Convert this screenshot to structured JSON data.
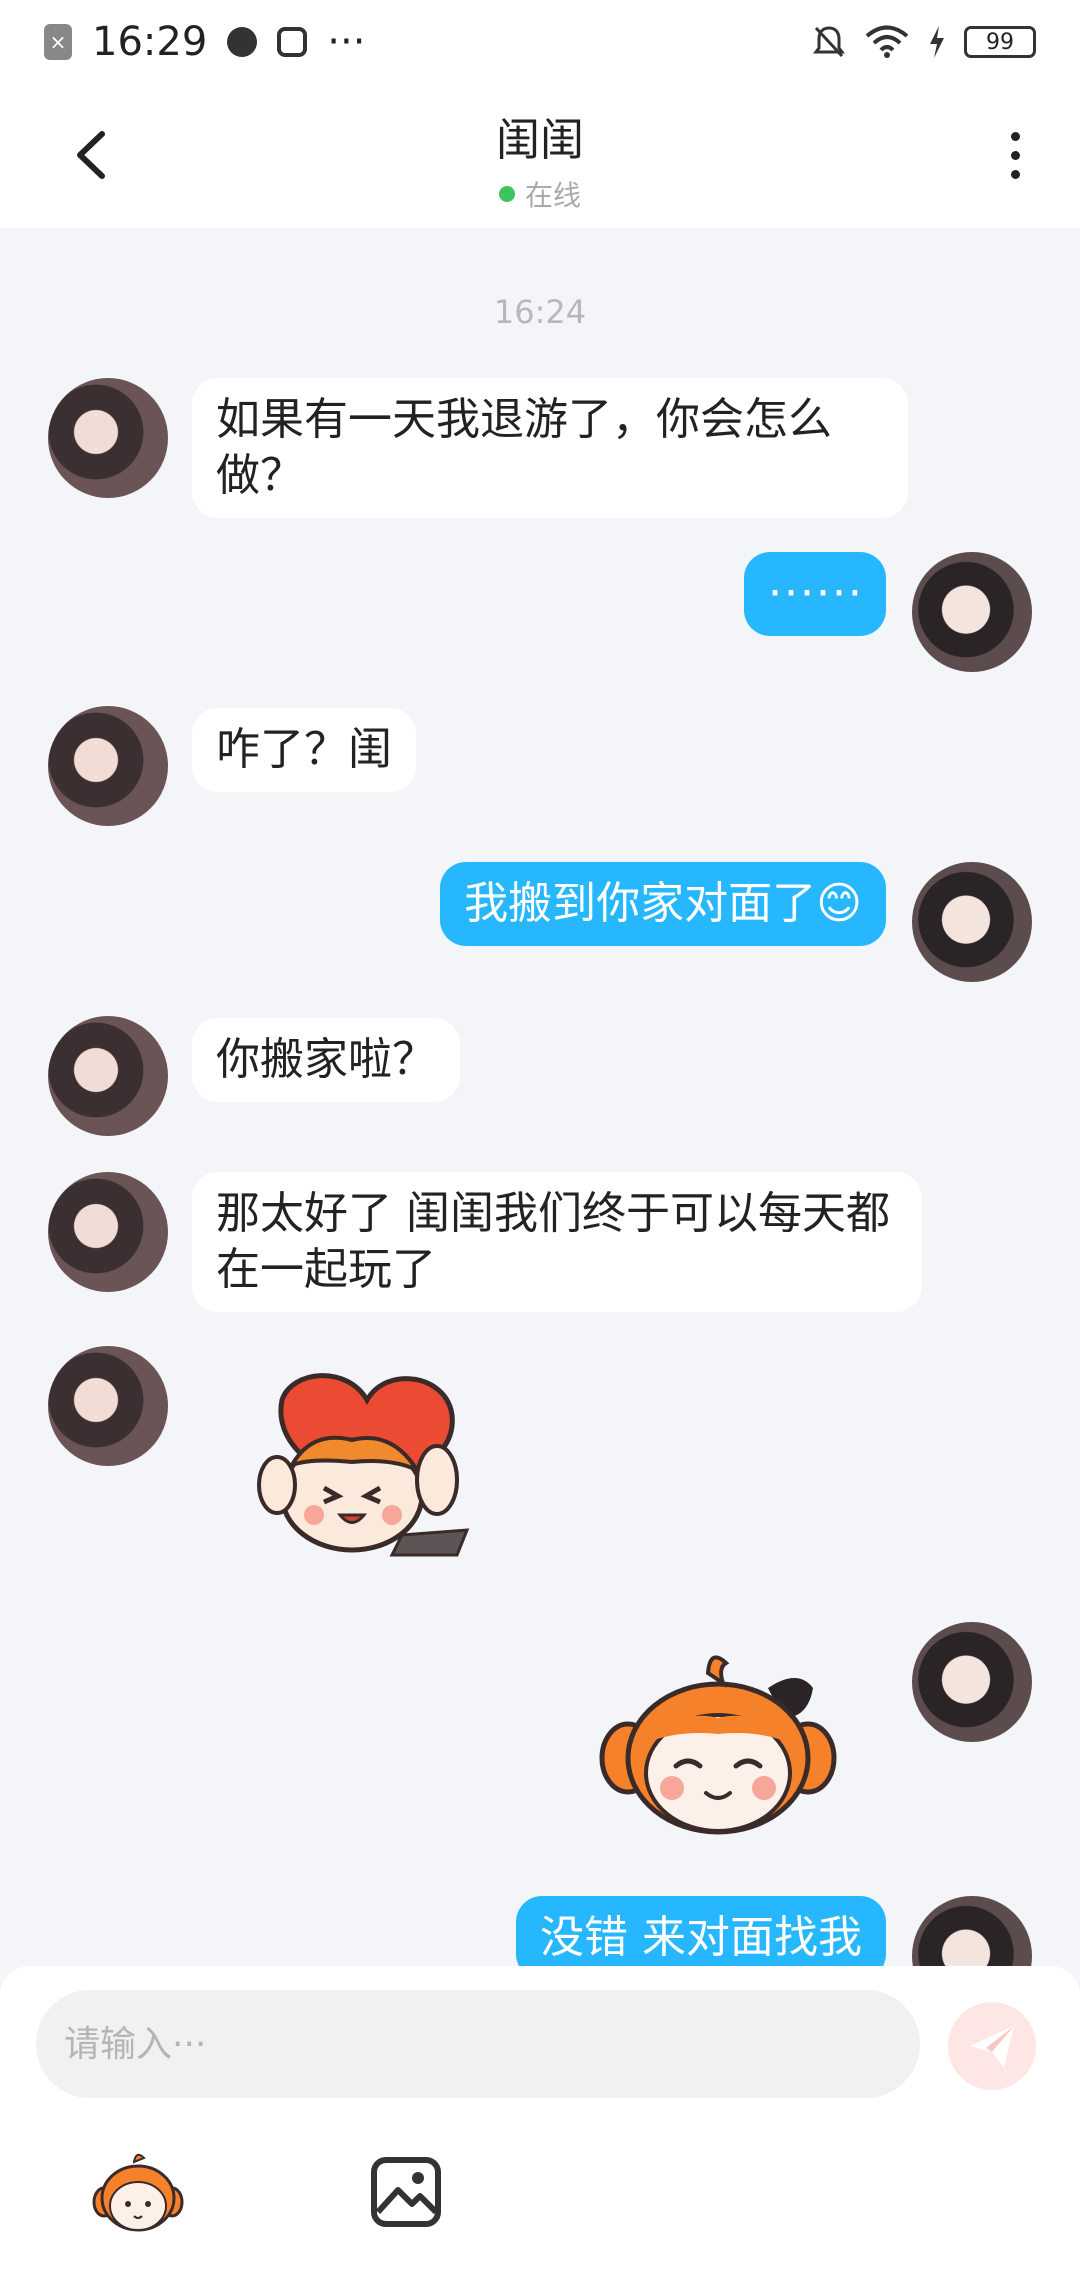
{
  "status_bar": {
    "time": "16:29",
    "overflow": "···",
    "battery": "99",
    "icons": [
      "notification-badge-icon",
      "planet-app-icon",
      "play-app-icon",
      "bell-off-icon",
      "wifi-icon",
      "charging-icon",
      "battery-icon"
    ]
  },
  "header": {
    "title": "闺闺",
    "status": "在线",
    "status_color": "#3ec45a"
  },
  "chat": {
    "timestamp": "16:24",
    "messages": [
      {
        "from": "friend",
        "text": "如果有一天我退游了，你会怎么做？"
      },
      {
        "from": "me",
        "text": "······"
      },
      {
        "from": "friend",
        "text": "咋了？闺"
      },
      {
        "from": "me",
        "text": "我搬到你家对面了😊"
      },
      {
        "from": "friend",
        "text": "你搬家啦？"
      },
      {
        "from": "friend",
        "text": "那太好了 闺闺我们终于可以每天都在一起玩了"
      },
      {
        "from": "friend",
        "sticker": "hug-pillow-sticker"
      },
      {
        "from": "me",
        "sticker": "smiling-mascot-sticker"
      },
      {
        "from": "me",
        "text": "没错 来对面找我"
      }
    ]
  },
  "composer": {
    "placeholder": "请输入···",
    "send_icon": "paper-plane-icon",
    "tools": [
      "mascot-emoji-icon",
      "image-icon"
    ]
  },
  "colors": {
    "outgoing_bubble": "#27b7ff",
    "incoming_bubble": "#ffffff",
    "background": "#f3f5f8",
    "send_button": "#fde6e4"
  }
}
